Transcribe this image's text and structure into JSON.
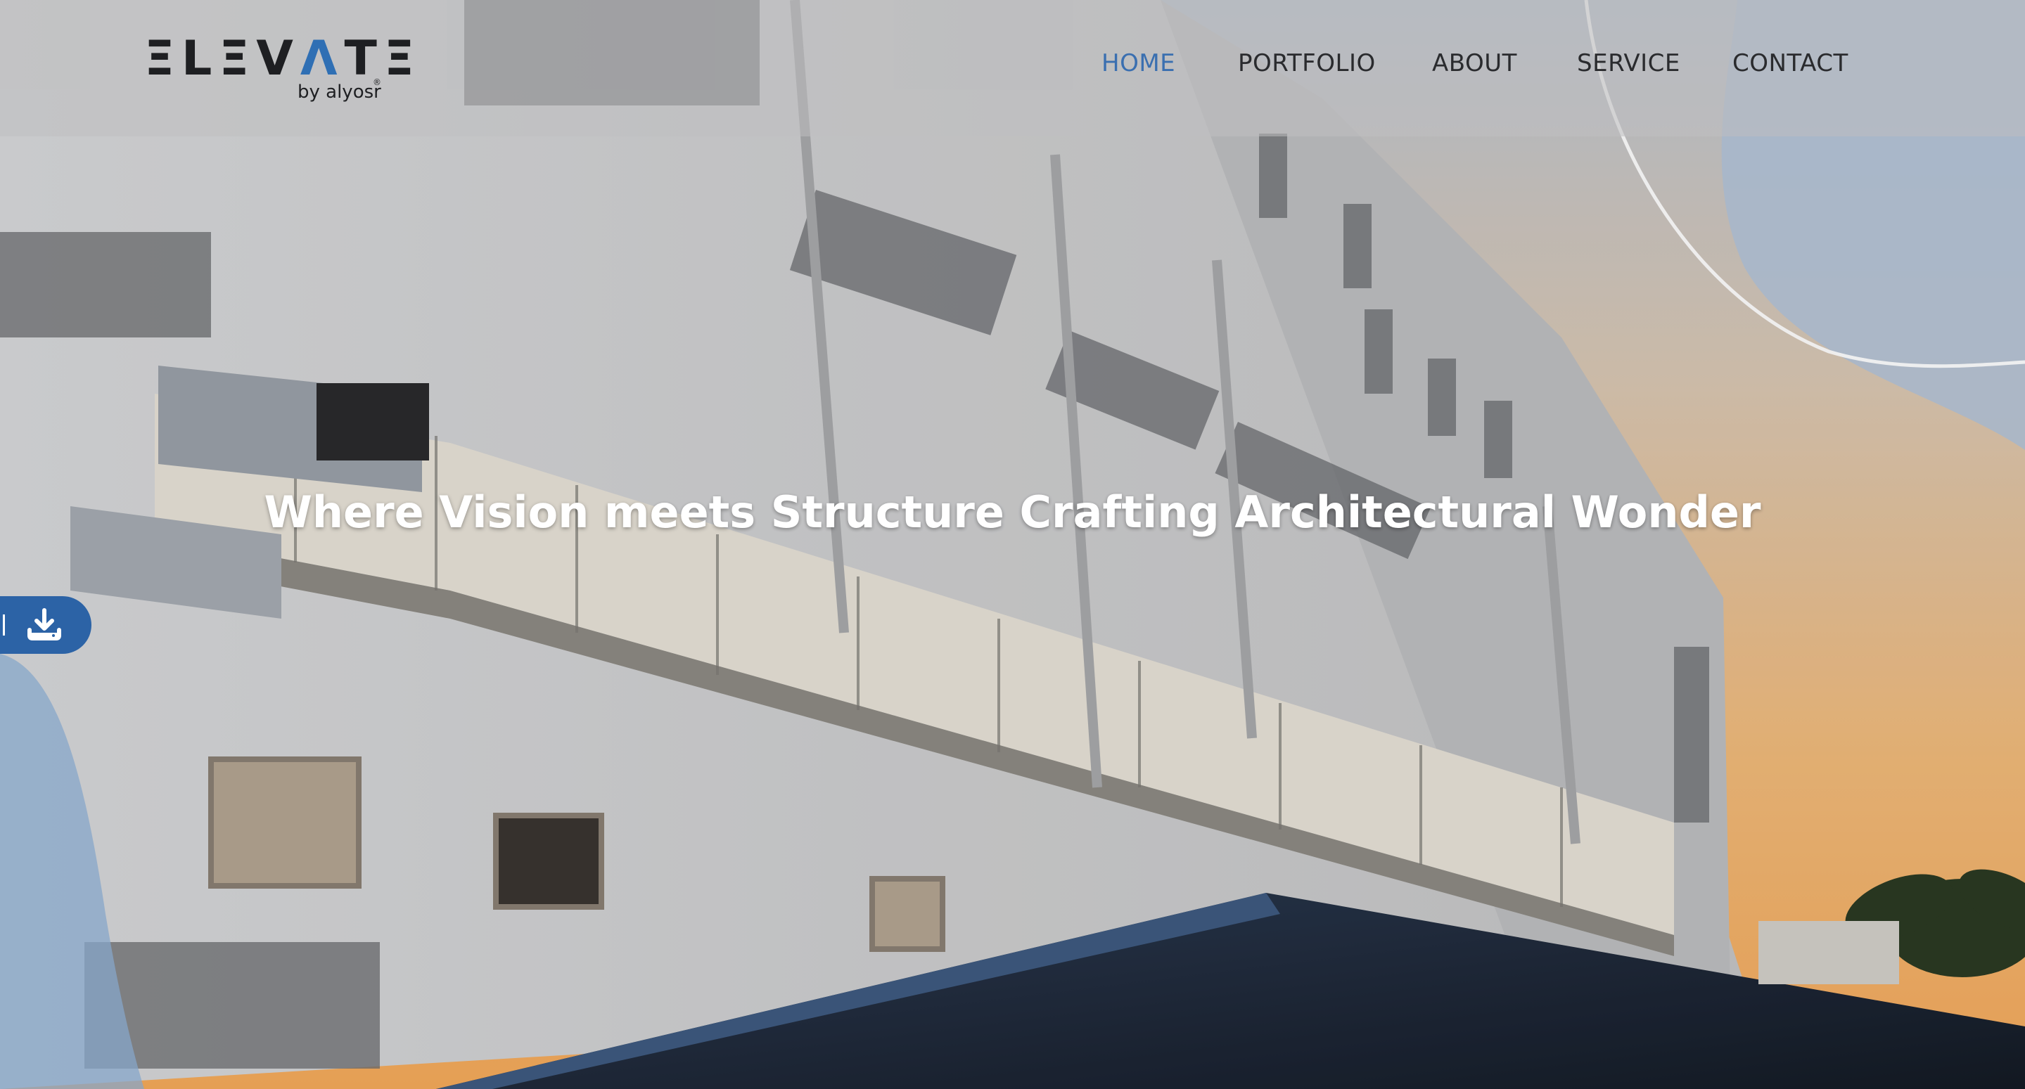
{
  "brand": {
    "name_part1": "ΞLΞV",
    "name_accent": "Λ",
    "name_part2": "TΞ",
    "tagline": "by alyosr",
    "registered": "®"
  },
  "nav": {
    "items": [
      {
        "label": "HOME",
        "active": true
      },
      {
        "label": "PORTFOLIO",
        "active": false
      },
      {
        "label": "ABOUT",
        "active": false
      },
      {
        "label": "SERVICE",
        "active": false
      },
      {
        "label": "CONTACT",
        "active": false
      }
    ]
  },
  "hero": {
    "title": "Where Vision meets Structure Crafting Architectural Wonder",
    "background_image": "building-facade-with-hvac-ducts"
  },
  "download": {
    "icon": "download-icon"
  },
  "colors": {
    "accent": "#2c63a6",
    "nav_active": "#3a6fb0",
    "nav_text": "#2a2b2e",
    "hero_text": "#ffffff"
  }
}
